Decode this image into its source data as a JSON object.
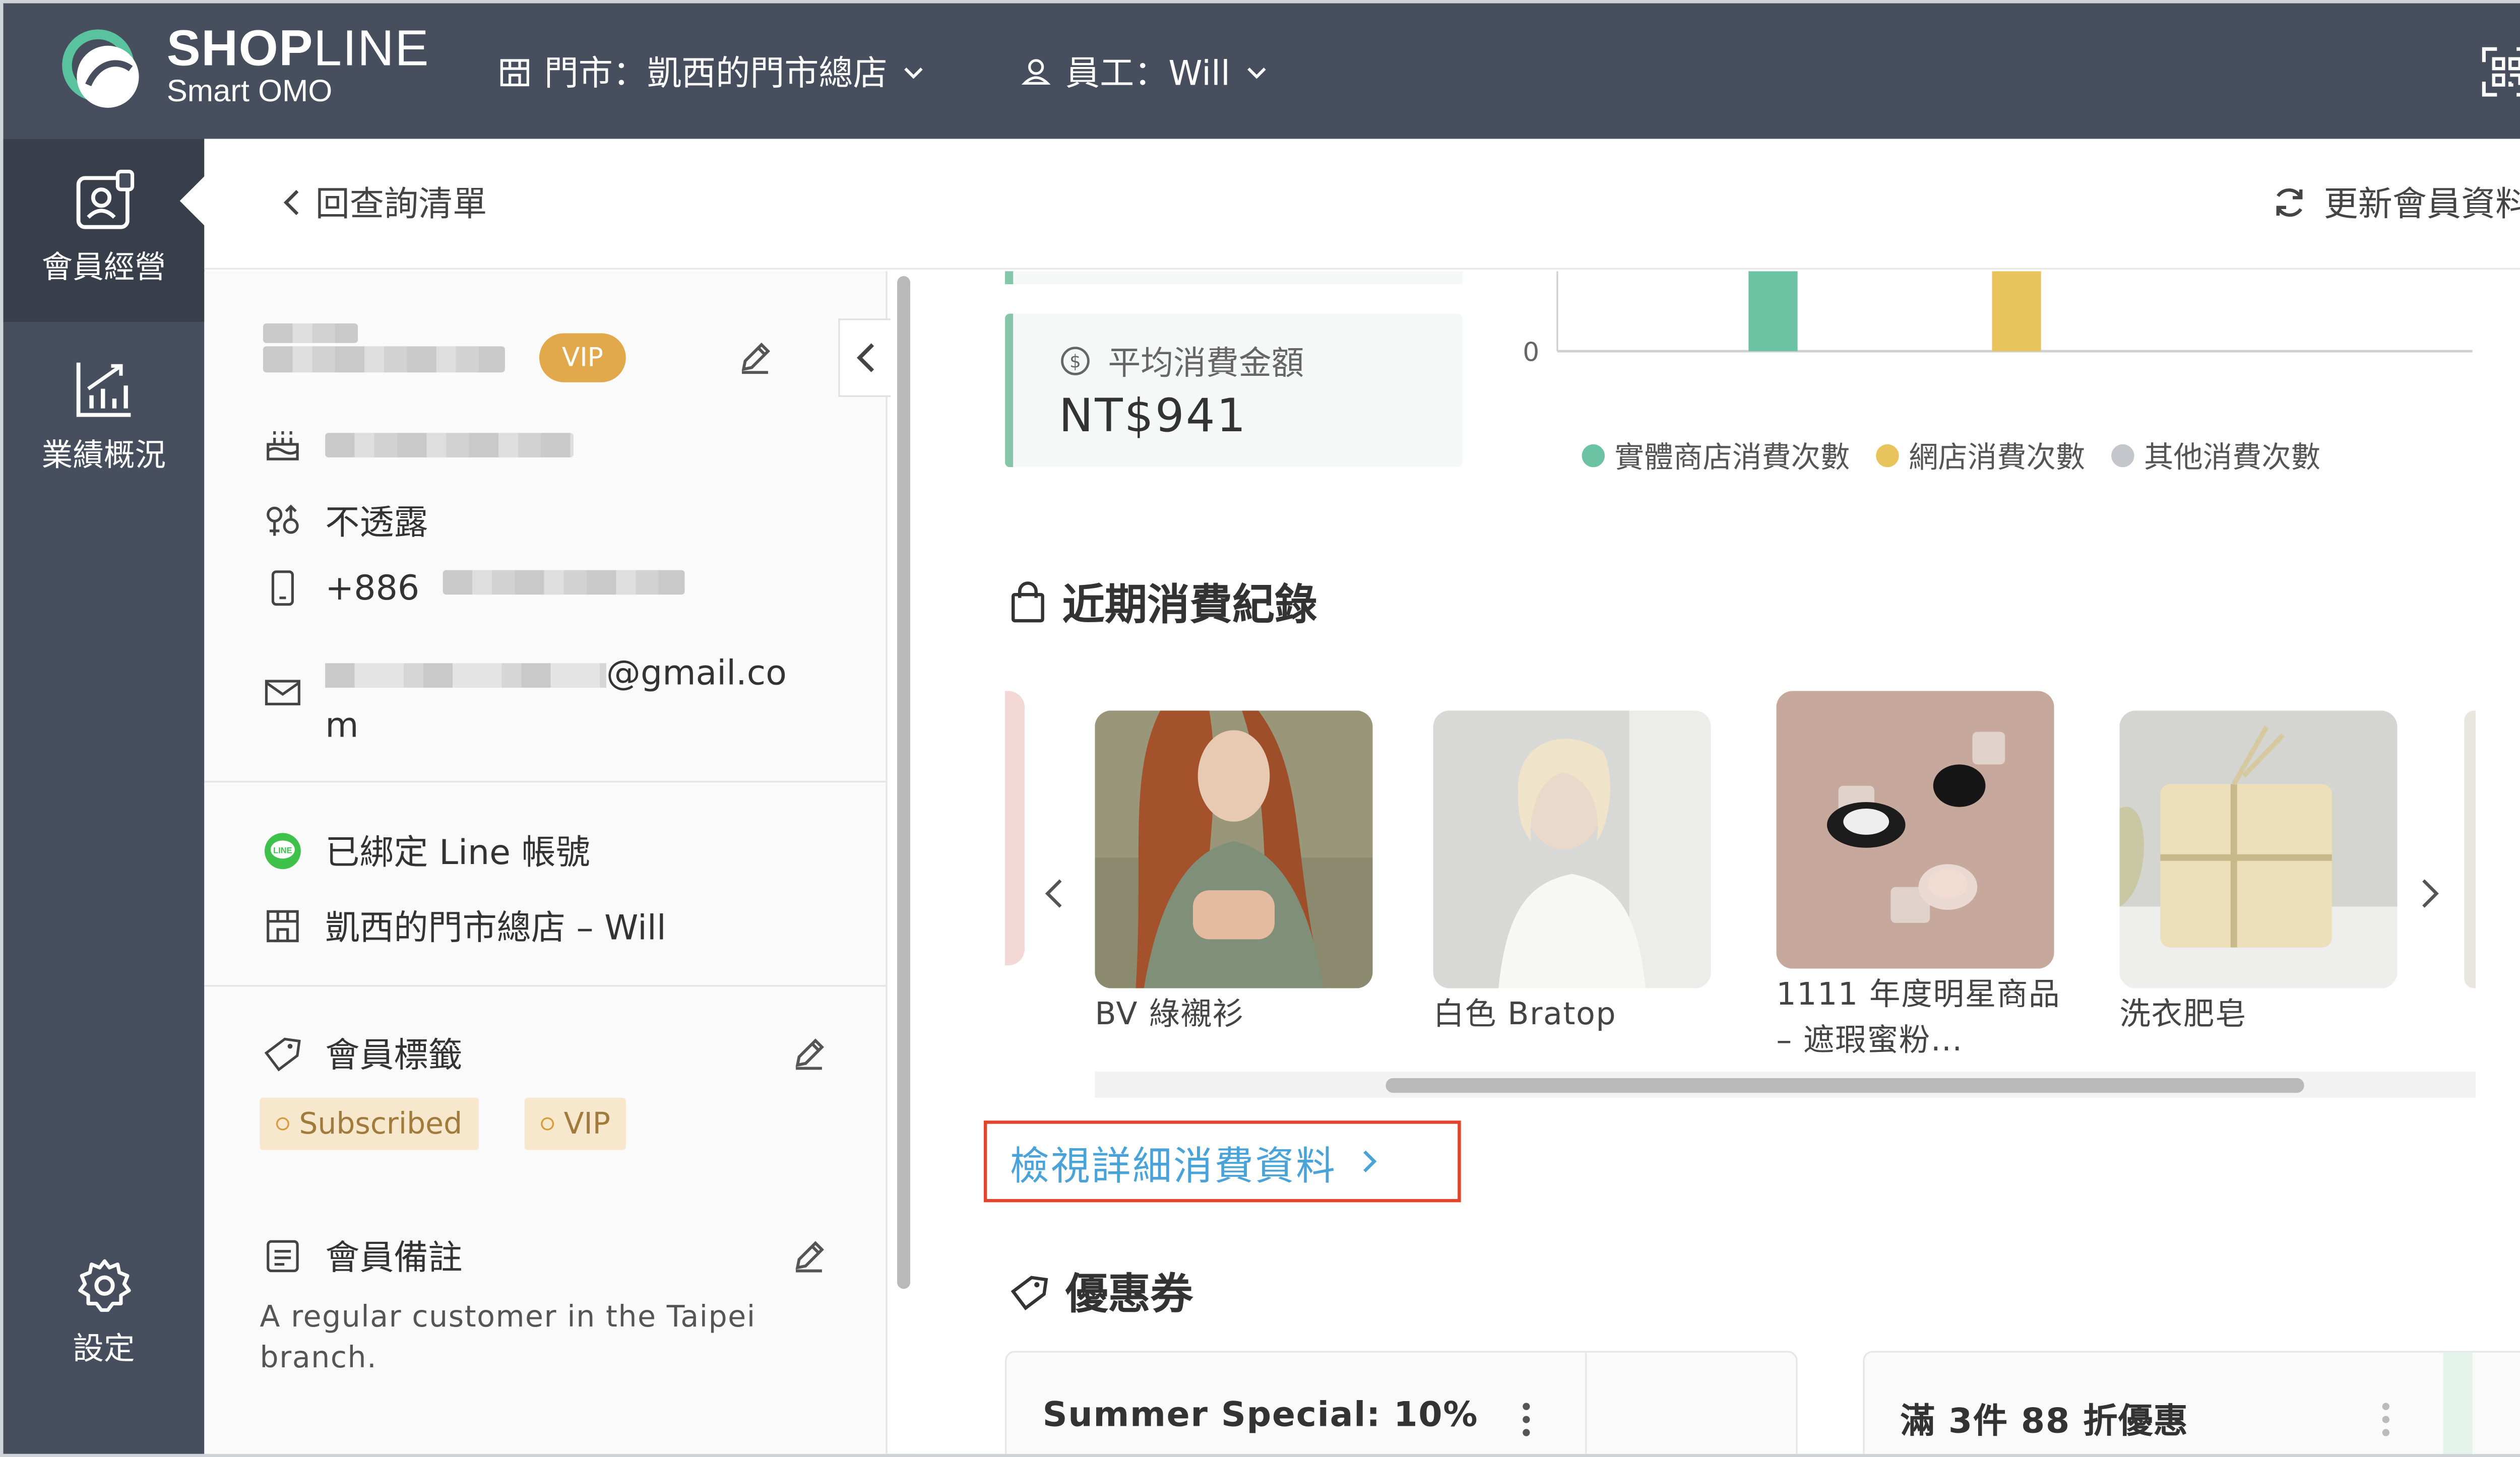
{
  "brand": {
    "name_bold": "SHOP",
    "name_thin": "LINE",
    "subtitle": "Smart OMO"
  },
  "topbar": {
    "store_label": "門市：凱西的門市總店",
    "staff_label": "員工：Will"
  },
  "rail": {
    "members": "會員經營",
    "performance": "業績概況",
    "settings": "設定"
  },
  "header": {
    "back": "回查詢清單",
    "refresh": "更新會員資料"
  },
  "profile": {
    "vip": "VIP",
    "gender": "不透露",
    "phone_prefix": "+886",
    "email_suffix": "@gmail.co",
    "email_wrap": "m",
    "line_bound": "已綁定 Line 帳號",
    "store_staff": "凱西的門市總店 – Will",
    "tags_title": "會員標籤",
    "tags": [
      "Subscribed",
      "VIP"
    ],
    "notes_title": "會員備註",
    "note_text": "A regular customer in the Taipei branch."
  },
  "stats": {
    "avg_label": "平均消費金額",
    "avg_value": "NT$941"
  },
  "chart_data": {
    "type": "bar",
    "title": "",
    "categories": [
      ""
    ],
    "y_tick": "0",
    "series": [
      {
        "name": "實體商店消費次數",
        "color": "#6cc3a3"
      },
      {
        "name": "網店消費次數",
        "color": "#e9c35c"
      },
      {
        "name": "其他消費次數",
        "color": "#c4c6cc"
      }
    ],
    "legend_position": "bottom"
  },
  "purchases": {
    "title": "近期消費紀錄",
    "items": [
      {
        "name": "BV 綠襯衫"
      },
      {
        "name": "白色 Bratop"
      },
      {
        "name": "1111 年度明星商品 – 遮瑕蜜粉..."
      },
      {
        "name": "洗衣肥皂"
      }
    ],
    "view_detail": "檢視詳細消費資料"
  },
  "coupons": {
    "title": "優惠券",
    "items": [
      {
        "title": "Summer Special: 10%"
      },
      {
        "title": "滿 3件 88 折優惠"
      }
    ]
  }
}
